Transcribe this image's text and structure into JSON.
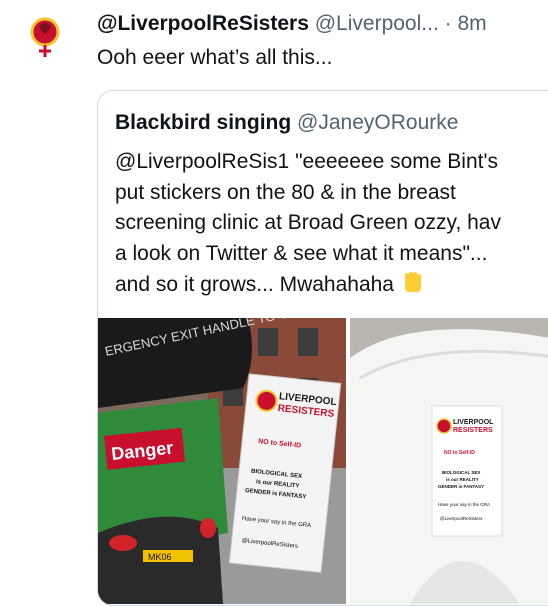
{
  "tweet": {
    "display_name": "@LiverpoolReSisters",
    "handle": "@Liverpool...",
    "separator": "·",
    "time": "8m",
    "text": "Ooh eeer what’s all this..."
  },
  "quoted_tweet": {
    "display_name": "Blackbird singing",
    "handle": "@JaneyORourke",
    "text_lines": [
      "@LiverpoolReSis1 \"eeeeeee some Bint's",
      "put stickers on the 80 & in the breast",
      "screening clinic at Broad Green ozzy, hav",
      "a look on Twitter & see what it means\"...",
      "and so it grows... Mwahahaha"
    ],
    "emoji": "fist-emoji"
  },
  "media": {
    "left_image": {
      "bus_sign": "ERGENCY EXIT HANDLE TO OPEN",
      "danger_label": "Danger",
      "plate": "MK06",
      "sticker_title_1": "LIVERPOOL",
      "sticker_title_2": "RESISTERS",
      "sticker_line_1": "NO to Self-ID",
      "sticker_line_2": "BIOLOGICAL SEX",
      "sticker_line_3": "is our REALITY",
      "sticker_line_4": "GENDER is FANTASY",
      "sticker_line_5": "Have your say in the GRA",
      "sticker_line_6": "@LiverpoolReSisters"
    },
    "right_image": {
      "sticker_title_1": "LIVERPOOL",
      "sticker_title_2": "RESISTERS",
      "sticker_line_1": "NO to Self-ID",
      "sticker_line_2": "BIOLOGICAL SEX",
      "sticker_line_3": "is our REALITY",
      "sticker_line_4": "GENDER is FANTASY",
      "sticker_line_5": "Have your say in the GRA",
      "sticker_line_6": "@LiverpoolReSisters"
    }
  },
  "colors": {
    "secondary_text": "#536471",
    "border": "#cfd9de",
    "logo_red": "#c8102e",
    "logo_yellow": "#f4c430"
  }
}
